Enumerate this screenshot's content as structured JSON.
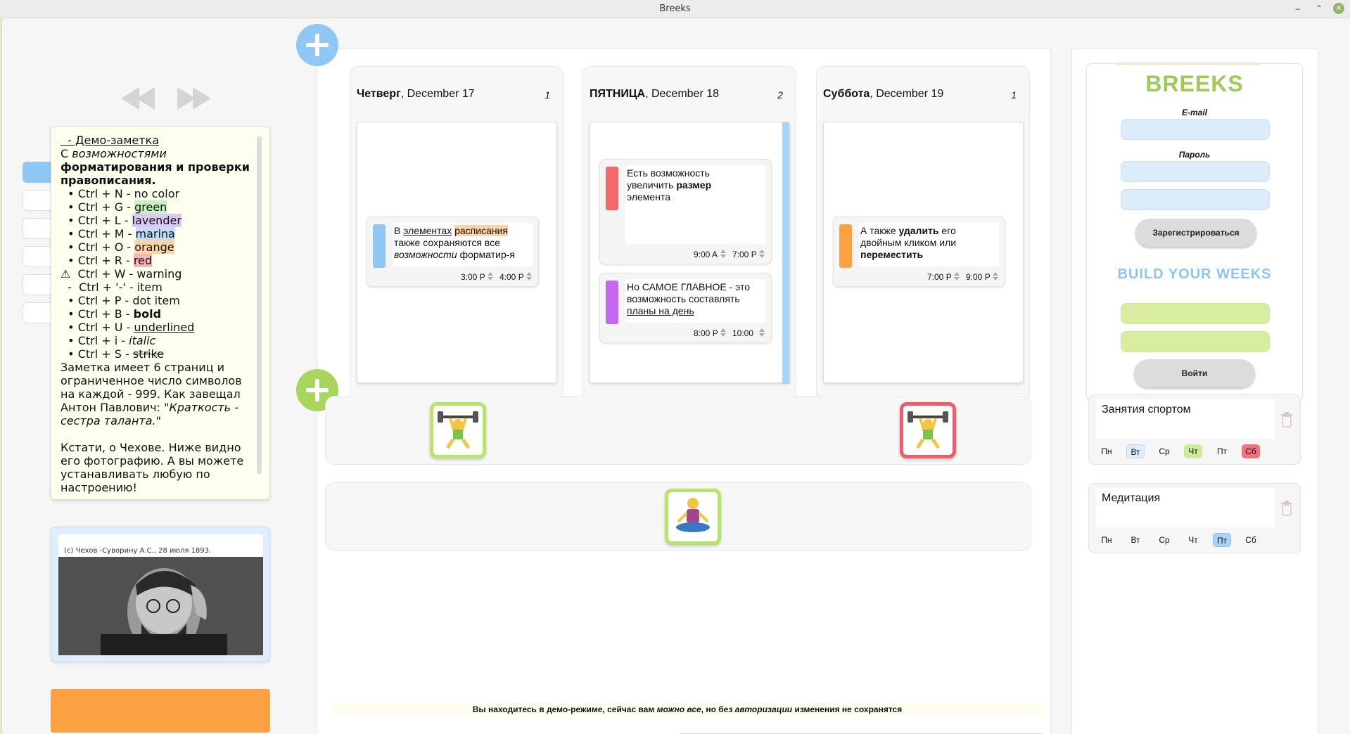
{
  "window": {
    "title": "Breeks"
  },
  "note": {
    "lines": [
      {
        "kind": "item",
        "text": " - Демо-заметка"
      },
      {
        "kind": "plain"
      },
      {
        "kind": "bold"
      },
      {
        "kind": "bold2"
      },
      {
        "kind": "color",
        "prefix": " • Ctrl + N - no color"
      },
      {
        "kind": "color"
      },
      {
        "kind": "color"
      },
      {
        "kind": "color"
      },
      {
        "kind": "color"
      },
      {
        "kind": "color"
      },
      {
        "kind": "plain"
      },
      {
        "kind": "plain"
      },
      {
        "kind": "plain"
      },
      {
        "kind": "plain"
      },
      {
        "kind": "plain"
      },
      {
        "kind": "plain"
      }
    ],
    "l1": "  - Демо-заметка",
    "l2a": "С ",
    "l2b": "возможностями",
    "l3": "форматирования и проверки",
    "l4": "правописания.",
    "l5": "  • Ctrl + N - no color",
    "l6a": "  • Ctrl + G - ",
    "l6b": "green",
    "l7a": "  • Ctrl + L - ",
    "l7b": "lavender",
    "l8a": "  • Ctrl + M - ",
    "l8b": "marina",
    "l9a": "  • Ctrl + O - ",
    "l9b": "orange",
    "l10a": "  • Ctrl + R - ",
    "l10b": "red",
    "l11": "⚠  Ctrl + W - warning",
    "l12": "  -  Ctrl + '-' - item",
    "l13": "  • Ctrl + P - dot item",
    "l14a": "  • Ctrl + B - ",
    "l14b": "bold",
    "l15a": "  • Ctrl + U - ",
    "l15b": "underlined",
    "l16a": "  • Ctrl + i - ",
    "l16b": "italic",
    "l17a": "  • Ctrl + S - ",
    "l17b": "strike",
    "l18": "Заметка имеет 6 страниц и",
    "l19": "ограниченное число символов",
    "l20": "на каждой - 999. Как завещал",
    "l21a": "Антон Павлович: ",
    "l21b": "\"Краткость -",
    "l22": "сестра таланта.\"",
    "l23": "Кстати, о Чехове. Ниже видно",
    "l24": "его фотографию. А вы можете",
    "l25": "устанавливать любую по",
    "l26": "настроению!"
  },
  "photo": {
    "caption": "(c) Чехов -Суворину А.С., 28 июля 1893."
  },
  "days": [
    {
      "name": "Четверг",
      "date": ", December 17",
      "count": "1",
      "tasks": [
        {
          "t1": "В ",
          "t2": "элементах",
          "t3": " ",
          "t4": "расписания",
          "t5": "также сохраняются все",
          "t6": "возможности",
          "t7": " форматир-я",
          "start": "3:00 P",
          "end": "4:00 P",
          "color": "#90c8f5"
        }
      ]
    },
    {
      "name": "ПЯТНИЦА",
      "date": ", December 18",
      "count": "2",
      "tasks": [
        {
          "a": "Есть возможность",
          "b1": "увеличить ",
          "b2": "размер",
          "c": "элемента",
          "start": "9:00 A",
          "end": "7:00 P",
          "color": "#f46a6a"
        },
        {
          "a": "Но САМОЕ ГЛАВНОЕ - это",
          "b": "возможность составлять",
          "c": "планы на день",
          "start": "8:00 P",
          "end": "10:00",
          "color": "#c667f0"
        }
      ]
    },
    {
      "name": "Суббота",
      "date": ", December 19",
      "count": "1",
      "tasks": [
        {
          "a1": "А также ",
          "a2": "удалить",
          "a3": " его",
          "b": "двойным кликом или",
          "c": "переместить",
          "start": "7:00 P",
          "end": "9:00 P",
          "color": "#fca141"
        }
      ]
    }
  ],
  "demo_banner": {
    "p1": "Вы находитесь в демо-режиме, сейчас вам ",
    "p2": "можно все",
    "p3": ", но без ",
    "p4": "авторизации",
    "p5": " изменения не сохранятся"
  },
  "auth": {
    "brand": "BREEKS",
    "email_label": "E-mail",
    "password_label": "Пароль",
    "register_label": "Зарегистрироваться",
    "slogan": "BUILD YOUR WEEKS",
    "login_label": "Войти"
  },
  "habits": [
    {
      "name": "Занятия спортом",
      "days": [
        "Пн",
        "Вт",
        "Ср",
        "Чт",
        "Пт",
        "Сб"
      ]
    },
    {
      "name": "Медитация",
      "days": [
        "Пн",
        "Вт",
        "Ср",
        "Чт",
        "Пт",
        "Сб"
      ]
    }
  ],
  "colors": {
    "accent_blue": "#90c8f5",
    "accent_green": "#9ccc55",
    "orange": "#fca141",
    "red": "#f46a6a",
    "purple": "#c667f0"
  },
  "icons": [
    "rewind-icon",
    "fast-forward-icon",
    "plus-icon",
    "trash-icon",
    "weightlifter-icon",
    "meditation-icon"
  ]
}
